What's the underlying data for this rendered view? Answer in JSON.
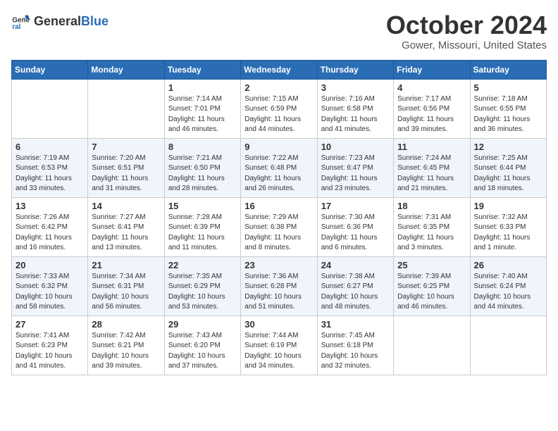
{
  "header": {
    "logo_general": "General",
    "logo_blue": "Blue",
    "month_title": "October 2024",
    "location": "Gower, Missouri, United States"
  },
  "days_of_week": [
    "Sunday",
    "Monday",
    "Tuesday",
    "Wednesday",
    "Thursday",
    "Friday",
    "Saturday"
  ],
  "weeks": [
    [
      {
        "day": "",
        "info": ""
      },
      {
        "day": "",
        "info": ""
      },
      {
        "day": "1",
        "info": "Sunrise: 7:14 AM\nSunset: 7:01 PM\nDaylight: 11 hours and 46 minutes."
      },
      {
        "day": "2",
        "info": "Sunrise: 7:15 AM\nSunset: 6:59 PM\nDaylight: 11 hours and 44 minutes."
      },
      {
        "day": "3",
        "info": "Sunrise: 7:16 AM\nSunset: 6:58 PM\nDaylight: 11 hours and 41 minutes."
      },
      {
        "day": "4",
        "info": "Sunrise: 7:17 AM\nSunset: 6:56 PM\nDaylight: 11 hours and 39 minutes."
      },
      {
        "day": "5",
        "info": "Sunrise: 7:18 AM\nSunset: 6:55 PM\nDaylight: 11 hours and 36 minutes."
      }
    ],
    [
      {
        "day": "6",
        "info": "Sunrise: 7:19 AM\nSunset: 6:53 PM\nDaylight: 11 hours and 33 minutes."
      },
      {
        "day": "7",
        "info": "Sunrise: 7:20 AM\nSunset: 6:51 PM\nDaylight: 11 hours and 31 minutes."
      },
      {
        "day": "8",
        "info": "Sunrise: 7:21 AM\nSunset: 6:50 PM\nDaylight: 11 hours and 28 minutes."
      },
      {
        "day": "9",
        "info": "Sunrise: 7:22 AM\nSunset: 6:48 PM\nDaylight: 11 hours and 26 minutes."
      },
      {
        "day": "10",
        "info": "Sunrise: 7:23 AM\nSunset: 6:47 PM\nDaylight: 11 hours and 23 minutes."
      },
      {
        "day": "11",
        "info": "Sunrise: 7:24 AM\nSunset: 6:45 PM\nDaylight: 11 hours and 21 minutes."
      },
      {
        "day": "12",
        "info": "Sunrise: 7:25 AM\nSunset: 6:44 PM\nDaylight: 11 hours and 18 minutes."
      }
    ],
    [
      {
        "day": "13",
        "info": "Sunrise: 7:26 AM\nSunset: 6:42 PM\nDaylight: 11 hours and 16 minutes."
      },
      {
        "day": "14",
        "info": "Sunrise: 7:27 AM\nSunset: 6:41 PM\nDaylight: 11 hours and 13 minutes."
      },
      {
        "day": "15",
        "info": "Sunrise: 7:28 AM\nSunset: 6:39 PM\nDaylight: 11 hours and 11 minutes."
      },
      {
        "day": "16",
        "info": "Sunrise: 7:29 AM\nSunset: 6:38 PM\nDaylight: 11 hours and 8 minutes."
      },
      {
        "day": "17",
        "info": "Sunrise: 7:30 AM\nSunset: 6:36 PM\nDaylight: 11 hours and 6 minutes."
      },
      {
        "day": "18",
        "info": "Sunrise: 7:31 AM\nSunset: 6:35 PM\nDaylight: 11 hours and 3 minutes."
      },
      {
        "day": "19",
        "info": "Sunrise: 7:32 AM\nSunset: 6:33 PM\nDaylight: 11 hours and 1 minute."
      }
    ],
    [
      {
        "day": "20",
        "info": "Sunrise: 7:33 AM\nSunset: 6:32 PM\nDaylight: 10 hours and 58 minutes."
      },
      {
        "day": "21",
        "info": "Sunrise: 7:34 AM\nSunset: 6:31 PM\nDaylight: 10 hours and 56 minutes."
      },
      {
        "day": "22",
        "info": "Sunrise: 7:35 AM\nSunset: 6:29 PM\nDaylight: 10 hours and 53 minutes."
      },
      {
        "day": "23",
        "info": "Sunrise: 7:36 AM\nSunset: 6:28 PM\nDaylight: 10 hours and 51 minutes."
      },
      {
        "day": "24",
        "info": "Sunrise: 7:38 AM\nSunset: 6:27 PM\nDaylight: 10 hours and 48 minutes."
      },
      {
        "day": "25",
        "info": "Sunrise: 7:39 AM\nSunset: 6:25 PM\nDaylight: 10 hours and 46 minutes."
      },
      {
        "day": "26",
        "info": "Sunrise: 7:40 AM\nSunset: 6:24 PM\nDaylight: 10 hours and 44 minutes."
      }
    ],
    [
      {
        "day": "27",
        "info": "Sunrise: 7:41 AM\nSunset: 6:23 PM\nDaylight: 10 hours and 41 minutes."
      },
      {
        "day": "28",
        "info": "Sunrise: 7:42 AM\nSunset: 6:21 PM\nDaylight: 10 hours and 39 minutes."
      },
      {
        "day": "29",
        "info": "Sunrise: 7:43 AM\nSunset: 6:20 PM\nDaylight: 10 hours and 37 minutes."
      },
      {
        "day": "30",
        "info": "Sunrise: 7:44 AM\nSunset: 6:19 PM\nDaylight: 10 hours and 34 minutes."
      },
      {
        "day": "31",
        "info": "Sunrise: 7:45 AM\nSunset: 6:18 PM\nDaylight: 10 hours and 32 minutes."
      },
      {
        "day": "",
        "info": ""
      },
      {
        "day": "",
        "info": ""
      }
    ]
  ]
}
